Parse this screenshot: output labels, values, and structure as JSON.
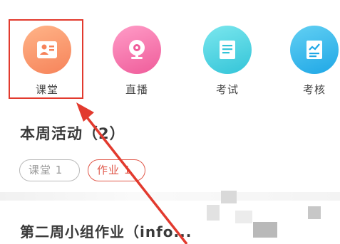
{
  "nav": {
    "items": [
      {
        "label": "课堂",
        "icon": "classroom-icon",
        "color": "#f6835a"
      },
      {
        "label": "直播",
        "icon": "webcam-icon",
        "color": "#ef5c9a"
      },
      {
        "label": "考试",
        "icon": "document-icon",
        "color": "#33c4d8"
      },
      {
        "label": "考核",
        "icon": "chart-document-icon",
        "color": "#1fa7e6"
      }
    ]
  },
  "activity": {
    "title": "本周活动（2）",
    "filters": [
      {
        "label": "课堂 1",
        "state": "inactive"
      },
      {
        "label": "作业 1",
        "state": "active"
      }
    ],
    "item_title": "第二周小组作业（info..."
  },
  "annotation": {
    "highlight_color": "#e23a2e"
  }
}
